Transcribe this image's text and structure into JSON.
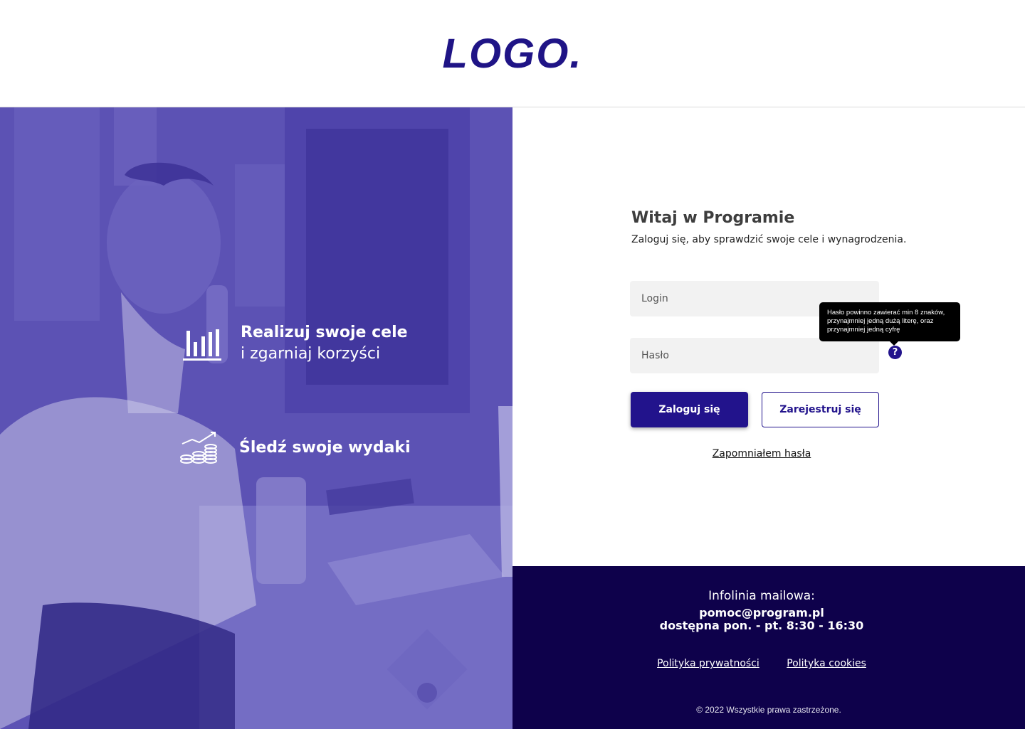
{
  "header": {
    "logo": "LOGO."
  },
  "hero": {
    "features": [
      {
        "icon": "bar-chart-icon",
        "title": "Realizuj swoje cele",
        "subtitle": "i zgarniaj korzyści"
      },
      {
        "icon": "coins-growth-icon",
        "title": "Śledź swoje wydaki"
      }
    ]
  },
  "login": {
    "title": "Witaj w Programie",
    "subtitle": "Zaloguj się, aby sprawdzić swoje cele i wynagrodzenia.",
    "login_placeholder": "Login",
    "password_placeholder": "Hasło",
    "help_symbol": "?",
    "tooltip": "Hasło powinno zawierać min 8 znaków, przynajmniej jedną dużą literę, oraz przynajmniej jedną cyfrę",
    "login_button": "Zaloguj się",
    "register_button": "Zarejestruj się",
    "forgot_link": "Zapomniałem hasła"
  },
  "footer": {
    "label": "Infolinia mailowa:",
    "email": "pomoc@program.pl",
    "hours": "dostępna pon. - pt. 8:30 - 16:30",
    "privacy": "Polityka prywatności",
    "cookies": "Polityka cookies",
    "copyright": "© 2022 Wszystkie prawa zastrzeżone."
  },
  "colors": {
    "brand": "#22138c",
    "overlay": "#5e54b6",
    "footer": "#0e014b"
  }
}
